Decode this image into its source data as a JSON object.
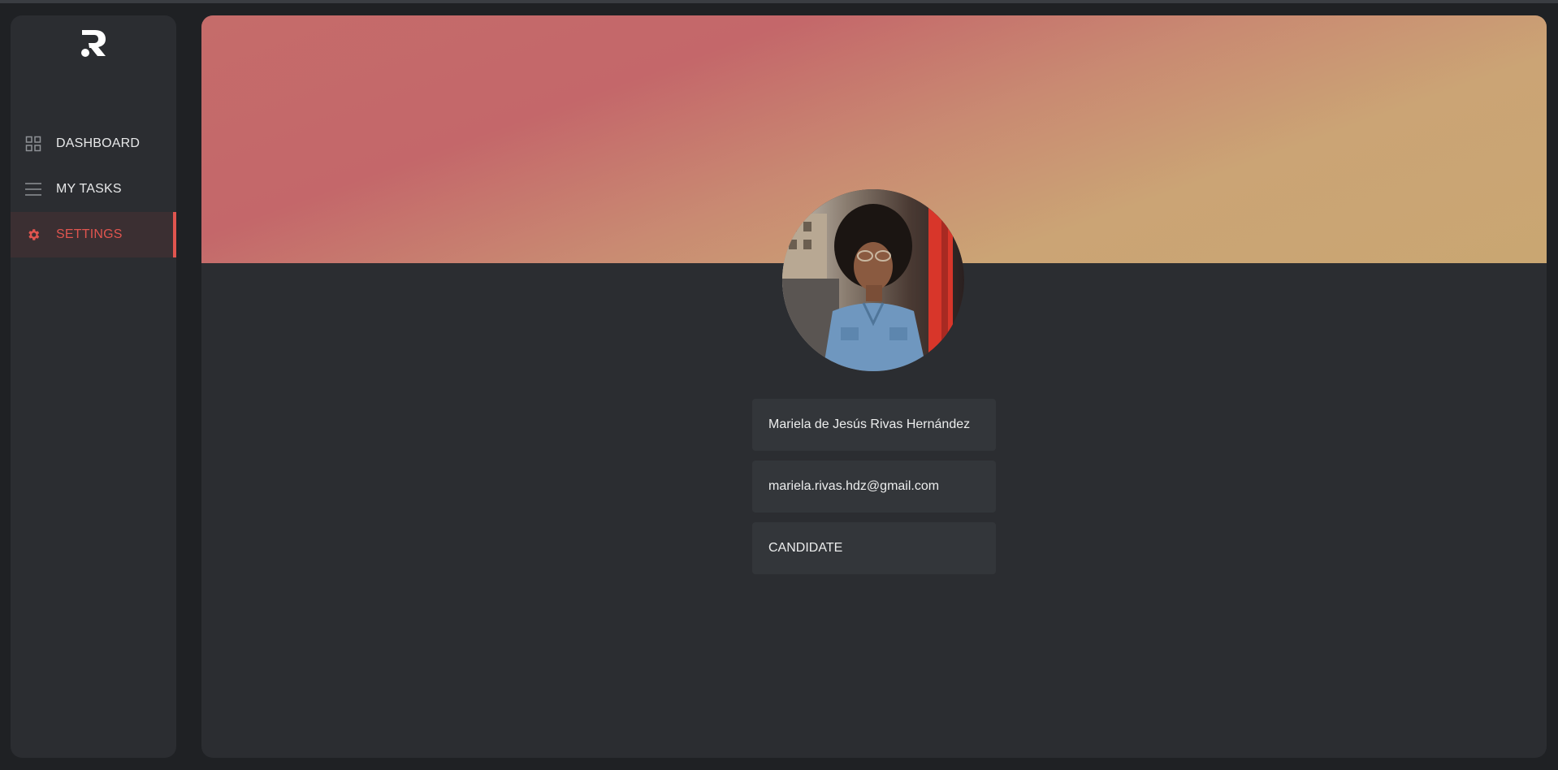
{
  "nav": {
    "items": [
      {
        "label": "DASHBOARD",
        "icon": "grid-icon",
        "active": false
      },
      {
        "label": "MY TASKS",
        "icon": "menu-lines-icon",
        "active": false
      },
      {
        "label": "SETTINGS",
        "icon": "gear-icon",
        "active": true
      }
    ]
  },
  "profile": {
    "name": "Mariela de Jesús Rivas Hernández",
    "email": "mariela.rivas.hdz@gmail.com",
    "role": "CANDIDATE"
  },
  "colors": {
    "accent": "#e0554f",
    "panel": "#2b2d31",
    "field": "#33363a"
  }
}
